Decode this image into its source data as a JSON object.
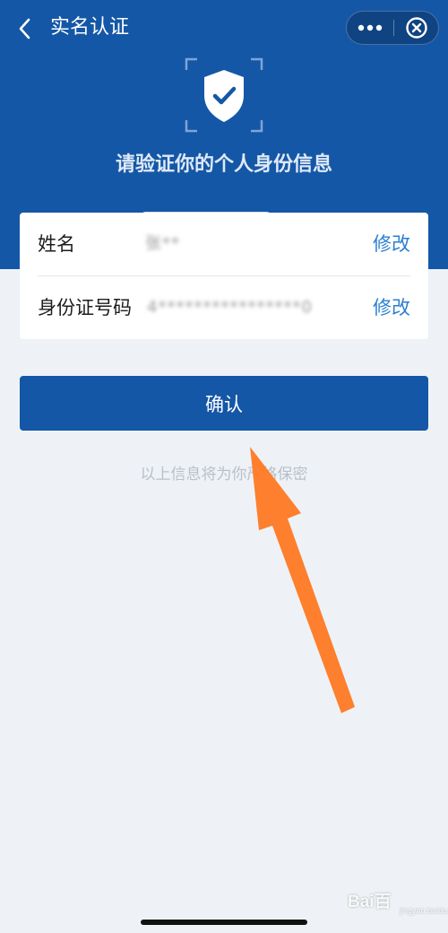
{
  "header": {
    "title": "实名认证",
    "back_icon": "chevron-left-icon",
    "more_icon": "more-dots-icon",
    "close_icon": "circle-close-icon"
  },
  "hero": {
    "icon": "shield-check-icon",
    "title": "请验证你的个人身份信息"
  },
  "form": {
    "rows": [
      {
        "label": "姓名",
        "value": "张**",
        "action": "修改"
      },
      {
        "label": "身份证号码",
        "value": "4****************0",
        "action": "修改"
      }
    ]
  },
  "confirm_label": "确认",
  "privacy_note": "以上信息将为你严格保密",
  "watermark": {
    "logo": "Bai百",
    "sub": "jingyan.baidu.com"
  },
  "colors": {
    "brand_blue": "#1457a6",
    "link_blue": "#2a7fd0",
    "page_bg": "#eef2f6",
    "annotation_arrow": "#fe7f2d"
  }
}
